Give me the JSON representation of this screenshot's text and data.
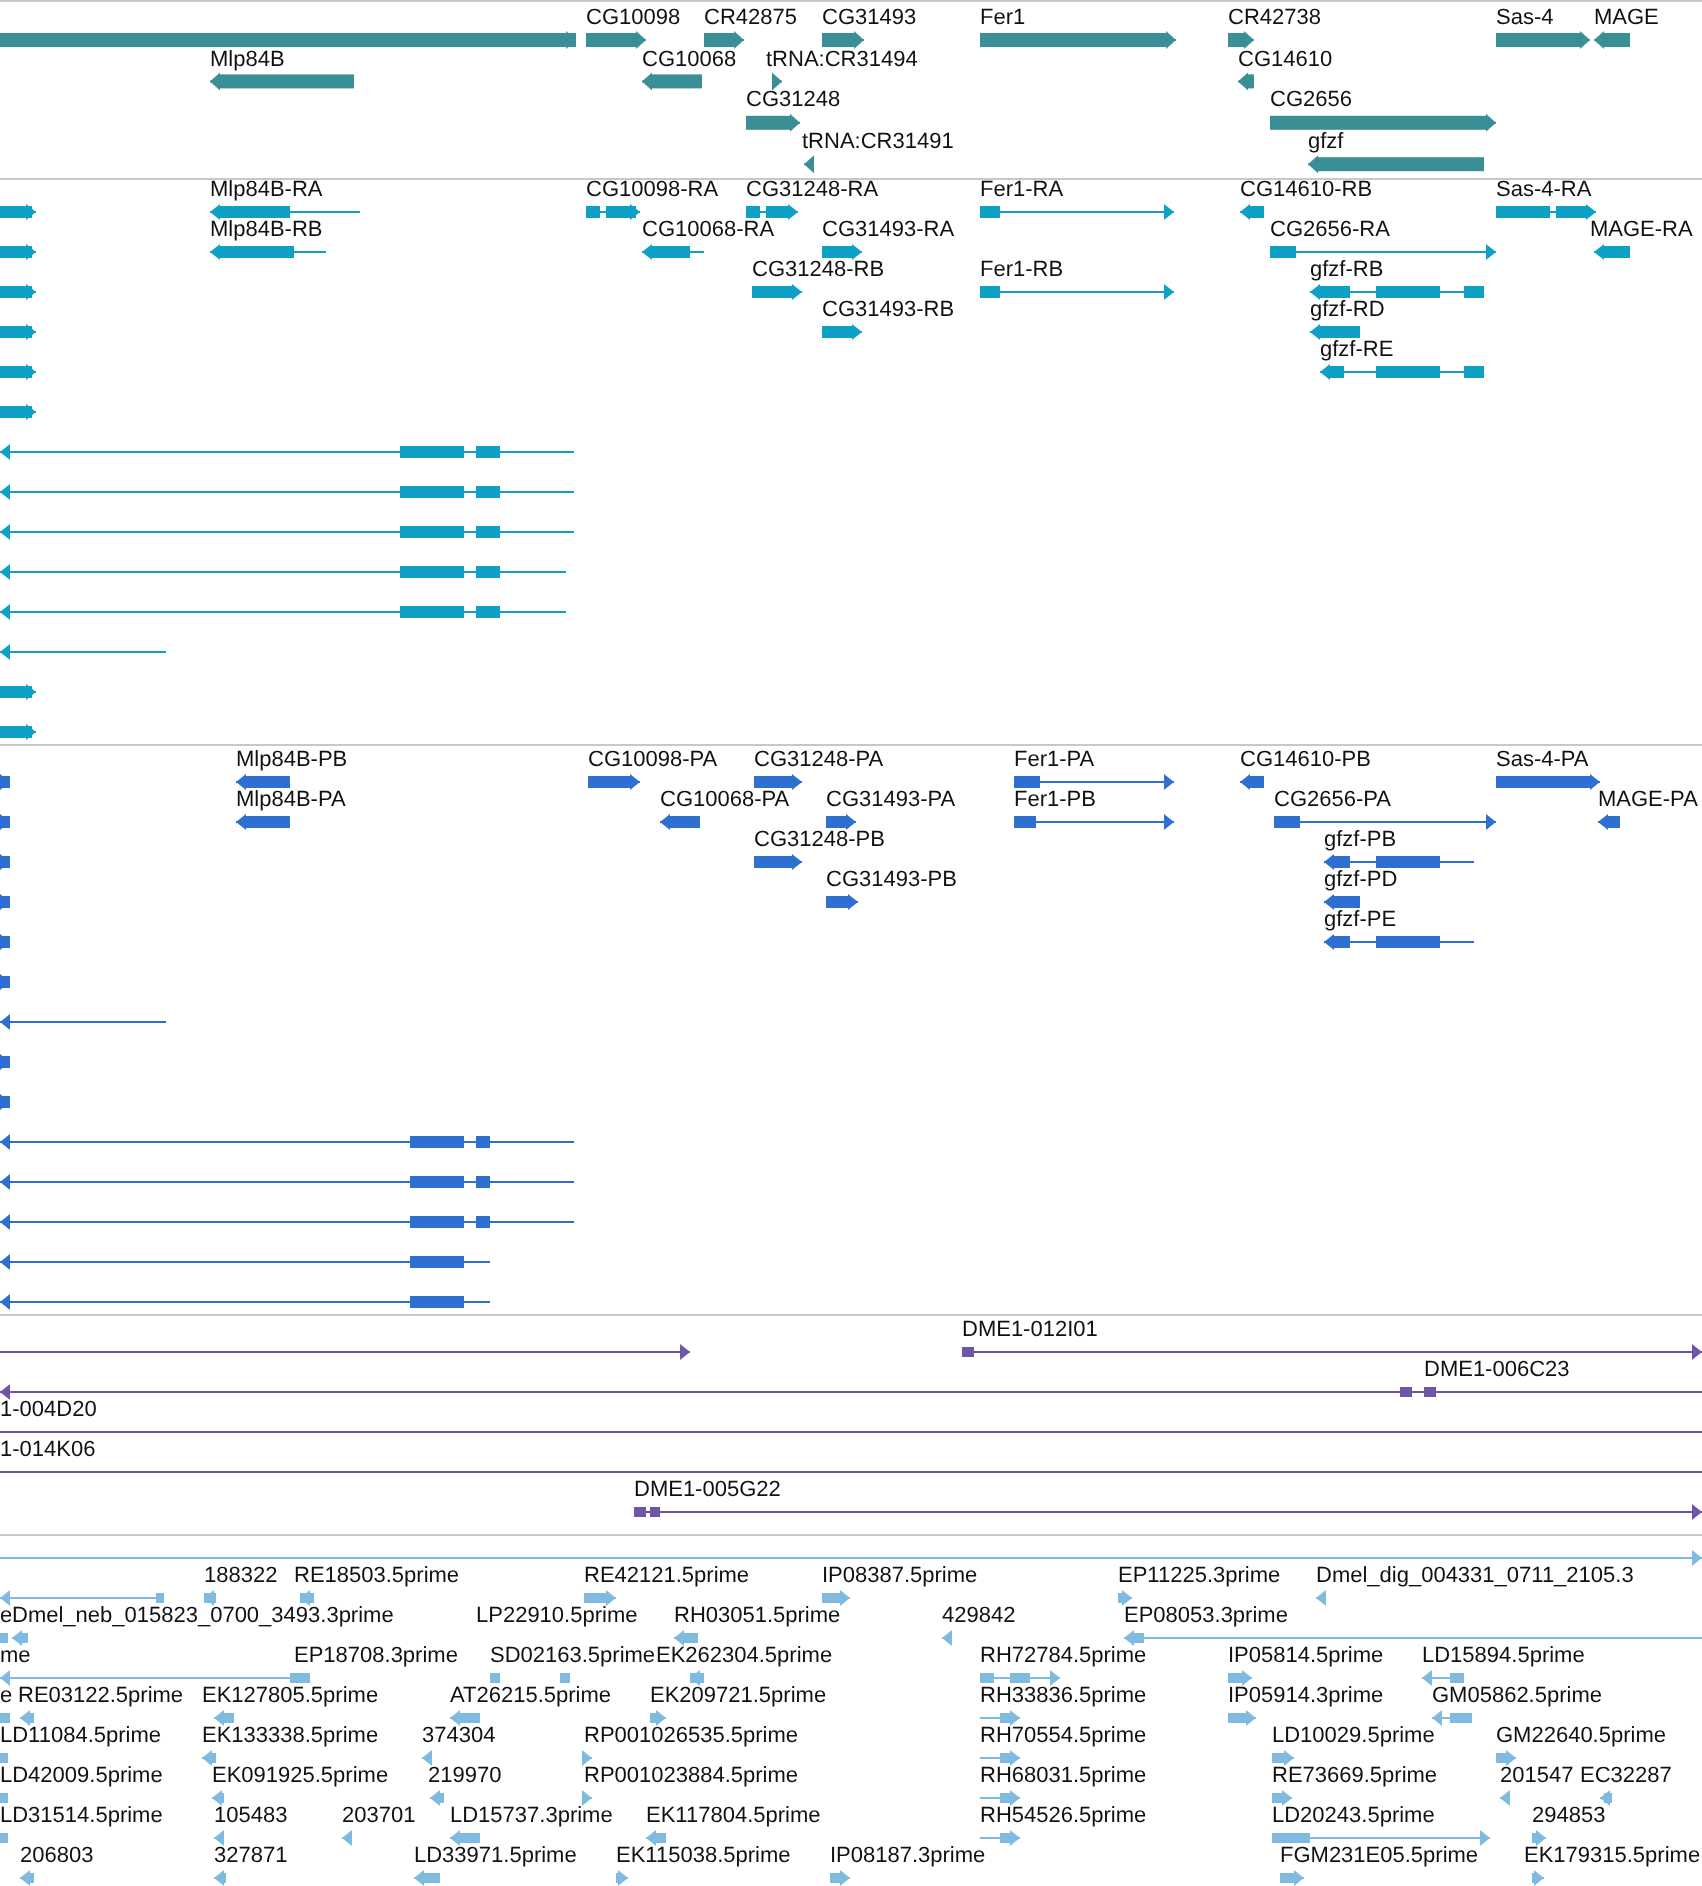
{
  "tracks": [
    {
      "kind": "gene",
      "color": "#3a8f96",
      "features": [
        {
          "reverse": false
        },
        {
          "label": "CG10098",
          "reverse": false
        },
        {
          "label": "CR42875",
          "reverse": false
        },
        {
          "label": "CG31493",
          "reverse": false
        },
        {
          "label": "Fer1",
          "reverse": false
        },
        {
          "label": "CR42738",
          "reverse": false
        },
        {
          "label": "Sas-4",
          "reverse": false
        },
        {
          "label": "MAGE",
          "reverse": true
        },
        {
          "label": "Mlp84B",
          "reverse": true
        },
        {
          "label": "CG10068",
          "reverse": true
        },
        {
          "label": "tRNA:CR31494",
          "reverse": false
        },
        {
          "label": "CG14610",
          "reverse": true
        },
        {
          "label": "CG31248",
          "reverse": false
        },
        {
          "label": "CG2656",
          "reverse": false
        },
        {
          "label": "tRNA:CR31491",
          "reverse": true
        },
        {
          "label": "gfzf",
          "reverse": true
        }
      ]
    },
    {
      "kind": "transcript",
      "color": "#0fa0c6",
      "features": [
        {
          "reverse": false
        },
        {
          "reverse": false
        },
        {
          "reverse": false
        },
        {
          "reverse": false
        },
        {
          "reverse": false
        },
        {
          "reverse": false
        },
        {
          "reverse": false
        },
        {
          "reverse": false
        },
        {
          "reverse": true
        },
        {
          "reverse": true
        },
        {
          "reverse": true
        },
        {
          "reverse": true
        },
        {
          "reverse": true
        },
        {
          "reverse": true
        },
        {
          "label": "Mlp84B-RA",
          "reverse": true
        },
        {
          "label": "CG10098-RA",
          "reverse": false
        },
        {
          "label": "CG31248-RA",
          "reverse": false
        },
        {
          "label": "Fer1-RA",
          "reverse": false
        },
        {
          "label": "CG14610-RB",
          "reverse": true
        },
        {
          "label": "Sas-4-RA",
          "reverse": false
        },
        {
          "label": "Mlp84B-RB",
          "reverse": true
        },
        {
          "label": "CG10068-RA",
          "reverse": true
        },
        {
          "label": "CG31493-RA",
          "reverse": false
        },
        {
          "label": "CG2656-RA",
          "reverse": false
        },
        {
          "label": "MAGE-RA",
          "reverse": true
        },
        {
          "label": "CG31248-RB",
          "reverse": false
        },
        {
          "label": "Fer1-RB",
          "reverse": false
        },
        {
          "label": "gfzf-RB",
          "reverse": true
        },
        {
          "label": "CG31493-RB",
          "reverse": false
        },
        {
          "label": "gfzf-RD",
          "reverse": true
        },
        {
          "label": "gfzf-RE",
          "reverse": true
        }
      ]
    },
    {
      "kind": "cds",
      "color": "#2f6fd2",
      "features": [
        {
          "reverse": false
        },
        {
          "reverse": false
        },
        {
          "reverse": false
        },
        {
          "reverse": false
        },
        {
          "reverse": false
        },
        {
          "reverse": false
        },
        {
          "reverse": false
        },
        {
          "reverse": false
        },
        {
          "reverse": true
        },
        {
          "reverse": true
        },
        {
          "reverse": true
        },
        {
          "reverse": true
        },
        {
          "reverse": true
        },
        {
          "reverse": true
        },
        {
          "label": "Mlp84B-PB",
          "reverse": true
        },
        {
          "label": "CG10098-PA",
          "reverse": false
        },
        {
          "label": "CG31248-PA",
          "reverse": false
        },
        {
          "label": "Fer1-PA",
          "reverse": false
        },
        {
          "label": "CG14610-PB",
          "reverse": true
        },
        {
          "label": "Sas-4-PA",
          "reverse": false
        },
        {
          "label": "Mlp84B-PA",
          "reverse": true
        },
        {
          "label": "CG10068-PA",
          "reverse": true
        },
        {
          "label": "CG31493-PA",
          "reverse": false
        },
        {
          "label": "Fer1-PB",
          "reverse": false
        },
        {
          "label": "CG2656-PA",
          "reverse": false
        },
        {
          "label": "MAGE-PA",
          "reverse": true
        },
        {
          "label": "CG31248-PB",
          "reverse": false
        },
        {
          "label": "gfzf-PB",
          "reverse": true
        },
        {
          "label": "CG31493-PB",
          "reverse": false
        },
        {
          "label": "gfzf-PD",
          "reverse": true
        },
        {
          "label": "gfzf-PE",
          "reverse": true
        }
      ]
    },
    {
      "kind": "clone",
      "color": "#6f55a8",
      "features": [
        {
          "reverse": false
        },
        {
          "label": "DME1-012I01",
          "reverse": false
        },
        {
          "label": "DME1-006C23",
          "reverse": true
        },
        {
          "label": "1-004D20"
        },
        {
          "label": "1-014K06"
        },
        {
          "label": "DME1-005G22",
          "reverse": false
        }
      ]
    },
    {
      "kind": "est",
      "color": "#7fbbe0",
      "features": [
        {
          "reverse": false
        },
        {
          "reverse": true
        },
        {
          "label": "188322",
          "reverse": true
        },
        {
          "label": "RE18503.5prime",
          "reverse": true
        },
        {
          "label": "RE42121.5prime",
          "reverse": false
        },
        {
          "label": "IP08387.5prime",
          "reverse": false
        },
        {
          "label": "EP11225.3prime",
          "reverse": false
        },
        {
          "label": "Dmel_dig_004331_0711_2105.3",
          "reverse": true
        },
        {
          "label": "e"
        },
        {
          "label": "Dmel_neb_015823_0700_3493.3prime",
          "reverse": true
        },
        {
          "label": "LP22910.5prime"
        },
        {
          "label": "RH03051.5prime",
          "reverse": true
        },
        {
          "label": "429842",
          "reverse": true
        },
        {
          "label": "EP08053.3prime",
          "reverse": true
        },
        {
          "label": "me"
        },
        {
          "label": "EP18708.3prime",
          "reverse": true
        },
        {
          "label": "SD02163.5prime"
        },
        {
          "label": "EK262304.5prime",
          "reverse": true
        },
        {
          "label": "RH72784.5prime",
          "reverse": false
        },
        {
          "label": "IP05814.5prime",
          "reverse": false
        },
        {
          "label": "LD15894.5prime",
          "reverse": true
        },
        {
          "label": "e"
        },
        {
          "label": "RE03122.5prime",
          "reverse": true
        },
        {
          "label": "EK127805.5prime",
          "reverse": true
        },
        {
          "label": "AT26215.5prime",
          "reverse": true
        },
        {
          "label": "EK209721.5prime",
          "reverse": false
        },
        {
          "label": "RH33836.5prime",
          "reverse": false
        },
        {
          "label": "IP05914.3prime",
          "reverse": false
        },
        {
          "label": "GM05862.5prime",
          "reverse": true
        },
        {
          "label": "LD11084.5prime"
        },
        {
          "label": "EK133338.5prime",
          "reverse": true
        },
        {
          "label": "374304",
          "reverse": true
        },
        {
          "label": "RP001026535.5prime",
          "reverse": false
        },
        {
          "label": "RH70554.5prime",
          "reverse": false
        },
        {
          "label": "LD10029.5prime",
          "reverse": false
        },
        {
          "label": "GM22640.5prime",
          "reverse": false
        },
        {
          "label": "LD42009.5prime"
        },
        {
          "label": "EK091925.5prime",
          "reverse": true
        },
        {
          "label": "219970",
          "reverse": true
        },
        {
          "label": "RP001023884.5prime",
          "reverse": false
        },
        {
          "label": "RH68031.5prime",
          "reverse": false
        },
        {
          "label": "RE73669.5prime",
          "reverse": false
        },
        {
          "label": "201547",
          "reverse": true
        },
        {
          "label": "EC32287",
          "reverse": true
        },
        {
          "label": "LD31514.5prime"
        },
        {
          "label": "105483",
          "reverse": true
        },
        {
          "label": "203701",
          "reverse": true
        },
        {
          "label": "LD15737.3prime",
          "reverse": true
        },
        {
          "label": "EK117804.5prime",
          "reverse": true
        },
        {
          "label": "RH54526.5prime",
          "reverse": false
        },
        {
          "label": "LD20243.5prime",
          "reverse": false
        },
        {
          "label": "294853",
          "reverse": false
        },
        {
          "label": "206803",
          "reverse": true
        },
        {
          "label": "327871",
          "reverse": true
        },
        {
          "label": "LD33971.5prime",
          "reverse": true
        },
        {
          "label": "EK115038.5prime",
          "reverse": false
        },
        {
          "label": "IP08187.3prime",
          "reverse": false
        },
        {
          "label": "FGM231E05.5prime",
          "reverse": false
        },
        {
          "label": "EK179315.5prime",
          "reverse": false
        }
      ]
    }
  ]
}
